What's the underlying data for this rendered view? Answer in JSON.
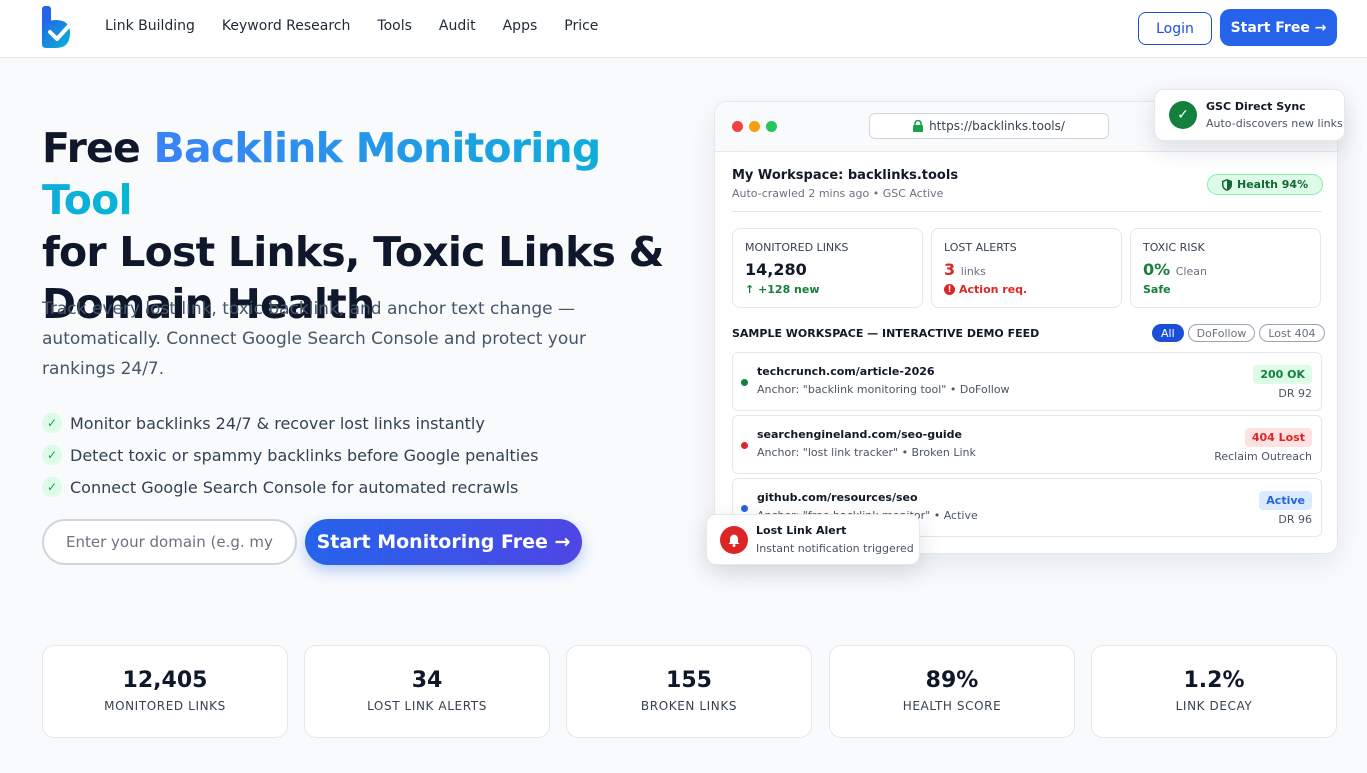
{
  "nav": {
    "logo_icon": "logo-check-icon",
    "links": [
      "Link Building",
      "Keyword Research",
      "Tools",
      "Audit",
      "Apps",
      "Price"
    ],
    "login": "Login",
    "start_free": "Start Free →"
  },
  "hero": {
    "title_part1": "Free ",
    "title_highlight": "Backlink Monitoring Tool",
    "title_part2": "for Lost Links, Toxic Links & Domain Health",
    "subtitle": "Track every lost link, toxic backlink, and anchor text change — automatically. Connect Google Search Console and protect your rankings 24/7.",
    "bullets": [
      "Monitor backlinks 24/7 & recover lost links instantly",
      "Detect toxic or spammy backlinks before Google penalties",
      "Connect Google Search Console for automated recrawls"
    ],
    "domain_placeholder": "Enter your domain (e.g. mywebsite.com)",
    "cta": "Start Monitoring Free →"
  },
  "demo": {
    "url": "https://backlinks.tools/",
    "workspace_title": "My Workspace: backlinks.tools",
    "workspace_sub": "Auto-crawled 2 mins ago • GSC Active",
    "health": "Health 94%",
    "metrics": [
      {
        "label": "Monitored Links",
        "value": "14,280",
        "unit": "",
        "note": "↑ +128 new",
        "note_color": "#15803d"
      },
      {
        "label": "Lost Alerts",
        "value": "3",
        "unit": "links",
        "note": "Action req.",
        "note_color": "#dc2626"
      },
      {
        "label": "Toxic Risk",
        "value": "0%",
        "unit": "Clean",
        "note": "Safe",
        "note_color": "#15803d"
      }
    ],
    "feed_title": "SAMPLE WORKSPACE — INTERACTIVE DEMO FEED",
    "filters": [
      "All",
      "DoFollow",
      "Lost 404"
    ],
    "feed": [
      {
        "url": "techcrunch.com/article-2026",
        "anchor": "Anchor: \"backlink monitoring tool\" • DoFollow",
        "badge": "200 OK",
        "meta": "DR 92",
        "dot": "#15803d",
        "badge_bg": "#dcfce7",
        "badge_fg": "#15803d"
      },
      {
        "url": "searchengineland.com/seo-guide",
        "anchor": "Anchor: \"lost link tracker\" • Broken Link",
        "badge": "404 Lost",
        "meta": "Reclaim Outreach",
        "dot": "#dc2626",
        "badge_bg": "#fee2e2",
        "badge_fg": "#dc2626"
      },
      {
        "url": "github.com/resources/seo",
        "anchor": "Anchor: \"free backlink monitor\" • Active",
        "badge": "Active",
        "meta": "DR 96",
        "dot": "#2563eb",
        "badge_bg": "#dbeafe",
        "badge_fg": "#2563eb"
      }
    ]
  },
  "gsc_card": {
    "title": "GSC Direct Sync",
    "sub": "Auto-discovers new links",
    "icon": "check-icon"
  },
  "alert_card": {
    "title": "Lost Link Alert",
    "sub": "Instant notification triggered",
    "icon": "bell-icon"
  },
  "stats": [
    {
      "value": "12,405",
      "label": "Monitored Links"
    },
    {
      "value": "34",
      "label": "Lost Link Alerts"
    },
    {
      "value": "155",
      "label": "Broken Links"
    },
    {
      "value": "89%",
      "label": "Health Score"
    },
    {
      "value": "1.2%",
      "label": "Link Decay"
    }
  ],
  "colors": {
    "brand": "#2563eb",
    "success": "#16a34a",
    "danger": "#dc2626"
  }
}
